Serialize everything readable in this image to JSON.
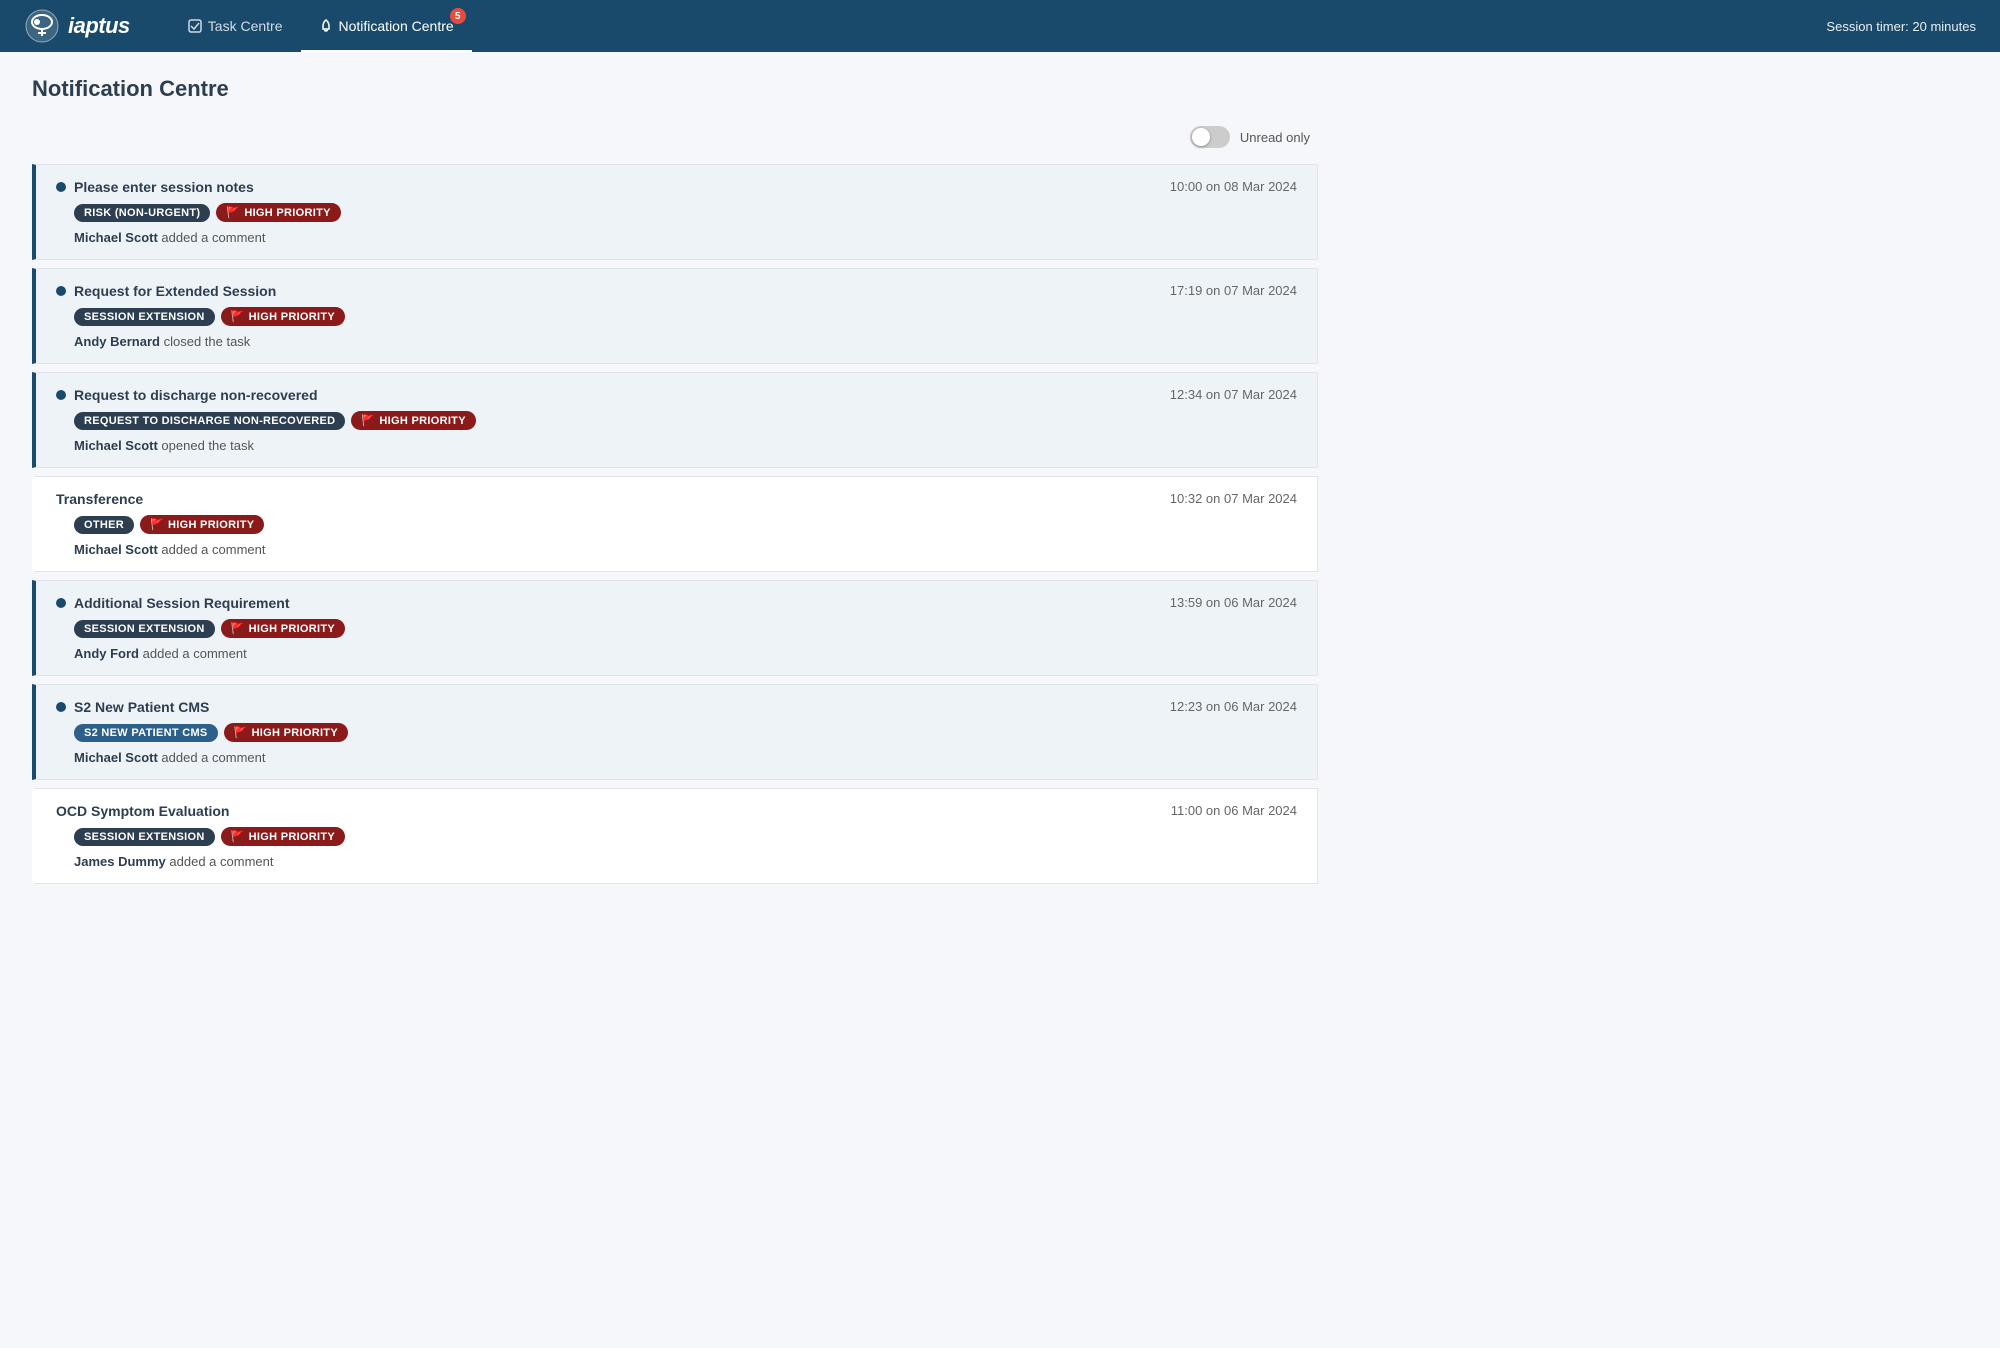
{
  "header": {
    "logo_text": "iaptus",
    "session_timer": "Session timer: 20 minutes",
    "nav_items": [
      {
        "label": "Task Centre",
        "icon": "checkbox-icon",
        "active": false
      },
      {
        "label": "Notification Centre",
        "icon": "bell-icon",
        "active": true,
        "badge": "5"
      }
    ]
  },
  "page": {
    "title": "Notification Centre"
  },
  "toggle": {
    "label": "Unread only",
    "enabled": false
  },
  "notifications": [
    {
      "id": 1,
      "unread": true,
      "title": "Please enter session notes",
      "time": "10:00 on 08 Mar 2024",
      "tags": [
        {
          "type": "category",
          "label": "RISK (NON-URGENT)"
        },
        {
          "type": "priority",
          "label": "HIGH PRIORITY"
        }
      ],
      "body_name": "Michael Scott",
      "body_action": "added a comment"
    },
    {
      "id": 2,
      "unread": true,
      "title": "Request for Extended Session",
      "time": "17:19 on 07 Mar 2024",
      "tags": [
        {
          "type": "category",
          "label": "SESSION EXTENSION"
        },
        {
          "type": "priority",
          "label": "HIGH PRIORITY"
        }
      ],
      "body_name": "Andy Bernard",
      "body_action": "closed the task"
    },
    {
      "id": 3,
      "unread": true,
      "title": "Request to discharge non-recovered",
      "time": "12:34 on 07 Mar 2024",
      "tags": [
        {
          "type": "category",
          "label": "REQUEST TO DISCHARGE NON-RECOVERED"
        },
        {
          "type": "priority",
          "label": "HIGH PRIORITY"
        }
      ],
      "body_name": "Michael Scott",
      "body_action": "opened the task"
    },
    {
      "id": 4,
      "unread": false,
      "title": "Transference",
      "time": "10:32 on 07 Mar 2024",
      "tags": [
        {
          "type": "other",
          "label": "OTHER"
        },
        {
          "type": "priority",
          "label": "HIGH PRIORITY"
        }
      ],
      "body_name": "Michael Scott",
      "body_action": "added a comment"
    },
    {
      "id": 5,
      "unread": true,
      "title": "Additional Session Requirement",
      "time": "13:59 on 06 Mar 2024",
      "tags": [
        {
          "type": "category",
          "label": "SESSION EXTENSION"
        },
        {
          "type": "priority",
          "label": "HIGH PRIORITY"
        }
      ],
      "body_name": "Andy Ford",
      "body_action": "added a comment"
    },
    {
      "id": 6,
      "unread": true,
      "title": "S2 New Patient CMS",
      "time": "12:23 on 06 Mar 2024",
      "tags": [
        {
          "type": "s2",
          "label": "S2 NEW PATIENT CMS"
        },
        {
          "type": "priority",
          "label": "HIGH PRIORITY"
        }
      ],
      "body_name": "Michael Scott",
      "body_action": "added a comment"
    },
    {
      "id": 7,
      "unread": false,
      "title": "OCD Symptom Evaluation",
      "time": "11:00 on 06 Mar 2024",
      "tags": [
        {
          "type": "category",
          "label": "SESSION EXTENSION"
        },
        {
          "type": "priority",
          "label": "HIGH PRIORITY"
        }
      ],
      "body_name": "James Dummy",
      "body_action": "added a comment"
    }
  ]
}
